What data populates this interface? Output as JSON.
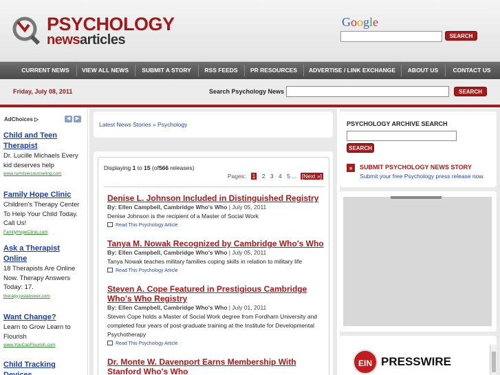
{
  "logo": {
    "line1": "PSYCHOLOGY",
    "line2a": "news",
    "line2b": "articles"
  },
  "google": {
    "letters": [
      "G",
      "o",
      "o",
      "g",
      "l",
      "e"
    ],
    "search_button": "SEARCH"
  },
  "nav": [
    "CURRENT NEWS",
    "VIEW ALL NEWS",
    "SUBMIT A STORY",
    "RSS FEEDS",
    "PR RESOURCES",
    "ADVERTISE / LINK EXCHANGE",
    "ABOUT US",
    "CONTACT US"
  ],
  "date": "Friday, July 08, 2011",
  "site_search": {
    "label": "Search Psychology News",
    "button": "SEARCH"
  },
  "ads": {
    "adchoices": "AdChoices ▷",
    "items": [
      {
        "title": "Child and Teen Therapist",
        "text": "Dr. Lucille Michaels Every kid deserves help",
        "url": "www.rumrivercounseling.com"
      },
      {
        "title": "Family Hope Clinic",
        "text": "Children's Therapy Center To Help Your Child Today. Call Us!",
        "url": "FamilyHopeClinic.com"
      },
      {
        "title": "Ask a Therapist Online",
        "text": "18 Therapists Are Online Now. Therapy Answers Today: 17.",
        "url": "therapy.justanswer.com"
      },
      {
        "title": "Want Change?",
        "text": "Learn to Grow Learn to Flourish",
        "url": "www.YouCanFlourish.com"
      },
      {
        "title": "Child Tracking Devices",
        "text": "",
        "url": ""
      }
    ]
  },
  "breadcrumb": {
    "home": "Latest News Stories",
    "sep": " » ",
    "current": "Psychology"
  },
  "listing": {
    "prefix": "Displaying",
    "from": "1",
    "to_word": "to",
    "to": "15",
    "of_prefix": "(of",
    "total": "566",
    "suffix": "releases)",
    "pages_label": "Pages:",
    "pages": [
      "1",
      "2",
      "3",
      "4",
      "5"
    ],
    "ellipsis": "...",
    "next": "[Next »]"
  },
  "articles": [
    {
      "title": "Denise L. Johnson Included in Distinguished Registry",
      "author": "By: Ellen Campbell, Cambridge Who's Who",
      "date": "| July 05, 2011",
      "desc": "Denise Johnson is the recipient of a Master of Social Work",
      "link": "Read This Psychology Article"
    },
    {
      "title": "Tanya M. Nowak Recognized by Cambridge Who's Who",
      "author": "By: Ellen Campbell, Cambridge Who's Who",
      "date": "| July 05, 2011",
      "desc": "Tanya Nowak teaches military families coping skills in relation to military life",
      "link": "Read This Psychology Article"
    },
    {
      "title": "Steven A. Cope Featured in Prestigious Cambridge Who's Who Registry",
      "author": "By: Ellen Campbell, Cambridge Who's Who",
      "date": "| July 01, 2011",
      "desc": "Steven Cope holds a Master of Social Work degree from Fordham University and completed four years of post-graduate training at the Institute for Developmental Psychotherapy",
      "link": "Read This Psychology Article"
    },
    {
      "title": "Dr. Monte W. Davenport Earns Membership With Stanford Who's Who",
      "author": "",
      "date": "",
      "desc": "",
      "link": ""
    }
  ],
  "archive": {
    "title": "PSYCHOLOGY ARCHIVE SEARCH",
    "button": "SEARCH",
    "submit_arrow": "»",
    "submit_title": "SUBMIT PSYCHOLOGY NEWS STORY",
    "submit_sub": "Submit your free Psychology press release now."
  },
  "ein": {
    "badge": "EIN",
    "name": "PRESSWIRE"
  },
  "colors": {
    "brand_red": "#a51b1b",
    "link_blue": "#2a4aa0",
    "nav_gray": "#5a5a5a"
  }
}
